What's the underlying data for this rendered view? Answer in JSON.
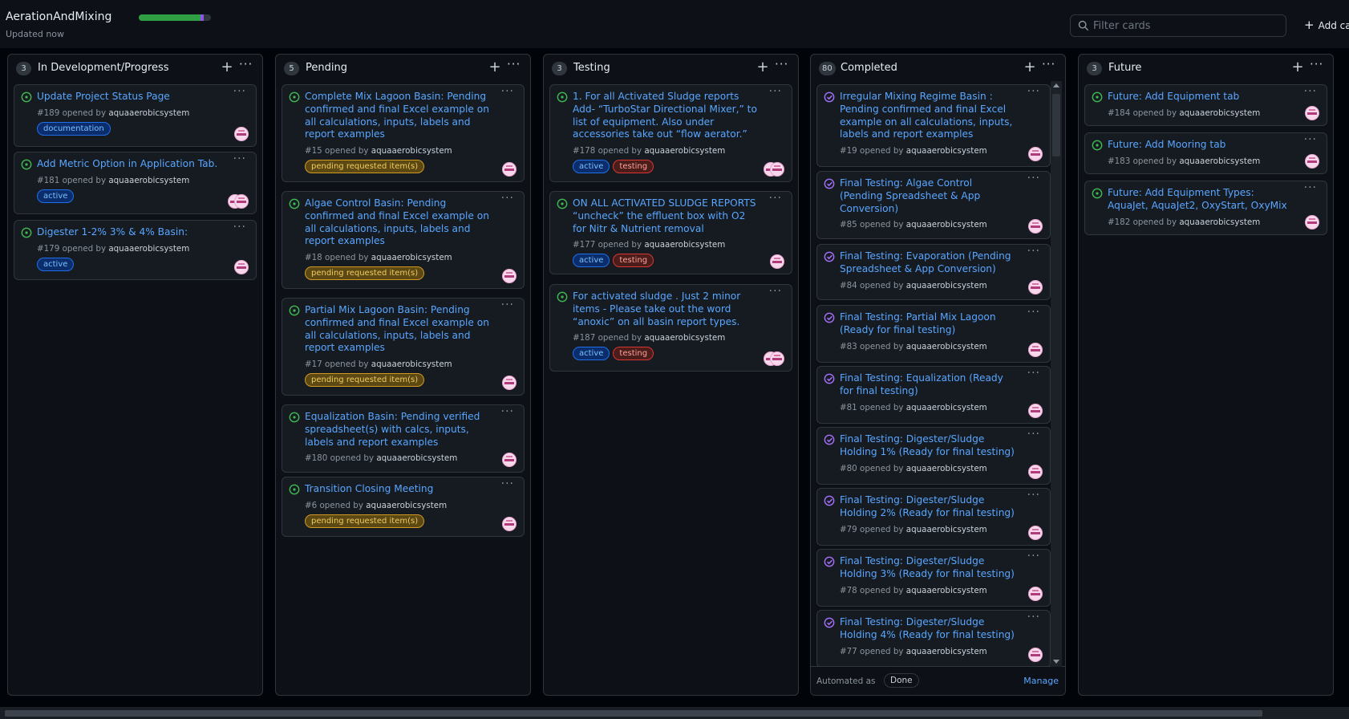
{
  "project": {
    "title": "AerationAndMixing",
    "updated": "Updated now",
    "progress_fraction": 0.9
  },
  "filter": {
    "placeholder": "Filter cards"
  },
  "add_cards_label": "Add cards",
  "colors": {
    "open_issue": "#3fb950",
    "closed_issue": "#a371f7",
    "link": "#58a6ff",
    "label_active": "#1f6feb",
    "label_testing": "#da3633",
    "label_pending": "#d29922"
  },
  "columns": [
    {
      "name": "In Development/Progress",
      "count": "3",
      "cards": [
        {
          "title": "Update Project Status Page",
          "number": "#189",
          "opened_by": "opened by",
          "author": "aquaaerobicsystem",
          "labels": [
            "documentation"
          ],
          "state": "open"
        },
        {
          "title": "Add Metric Option in Application Tab.",
          "number": "#181",
          "opened_by": "opened by",
          "author": "aquaaerobicsystem",
          "labels": [
            "active"
          ],
          "state": "open"
        },
        {
          "title": "Digester 1-2% 3% & 4% Basin:",
          "number": "#179",
          "opened_by": "opened by",
          "author": "aquaaerobicsystem",
          "labels": [
            "active"
          ],
          "state": "open"
        }
      ]
    },
    {
      "name": "Pending",
      "count": "5",
      "cards": [
        {
          "title": "Complete Mix Lagoon Basin: Pending confirmed and final Excel example on all calculations, inputs, labels and report examples",
          "number": "#15",
          "opened_by": "opened by",
          "author": "aquaaerobicsystem",
          "labels": [
            "pending requested item(s)"
          ],
          "state": "open"
        },
        {
          "title": "Algae Control Basin: Pending confirmed and final Excel example on all calculations, inputs, labels and report examples",
          "number": "#18",
          "opened_by": "opened by",
          "author": "aquaaerobicsystem",
          "labels": [
            "pending requested item(s)"
          ],
          "state": "open"
        },
        {
          "title": "Partial Mix Lagoon Basin: Pending confirmed and final Excel example on all calculations, inputs, labels and report examples",
          "number": "#17",
          "opened_by": "opened by",
          "author": "aquaaerobicsystem",
          "labels": [
            "pending requested item(s)"
          ],
          "state": "open"
        },
        {
          "title": "Equalization Basin: Pending verified spreadsheet(s) with calcs, inputs, labels and report examples",
          "number": "#180",
          "opened_by": "opened by",
          "author": "aquaaerobicsystem",
          "labels": [],
          "state": "open"
        },
        {
          "title": "Transition Closing Meeting",
          "number": "#6",
          "opened_by": "opened by",
          "author": "aquaaerobicsystem",
          "labels": [
            "pending requested item(s)"
          ],
          "state": "open"
        }
      ]
    },
    {
      "name": "Testing",
      "count": "3",
      "cards": [
        {
          "title": "1. For all Activated Sludge reports Add- “TurboStar Directional Mixer,” to list of equipment. Also under accessories take out “flow aerator.”",
          "number": "#178",
          "opened_by": "opened by",
          "author": "aquaaerobicsystem",
          "labels": [
            "active",
            "testing"
          ],
          "state": "open"
        },
        {
          "title": "ON ALL ACTIVATED SLUDGE REPORTS “uncheck” the effluent box with O2 for Nitr & Nutrient removal",
          "number": "#177",
          "opened_by": "opened by",
          "author": "aquaaerobicsystem",
          "labels": [
            "active",
            "testing"
          ],
          "state": "open"
        },
        {
          "title": "For activated sludge . Just 2 minor items - Please take out the word “anoxic” on all basin report types.",
          "number": "#187",
          "opened_by": "opened by",
          "author": "aquaaerobicsystem",
          "labels": [
            "active",
            "testing"
          ],
          "state": "open"
        }
      ]
    },
    {
      "name": "Completed",
      "count": "80",
      "cards": [
        {
          "title": "Irregular Mixing Regime Basin : Pending confirmed and final Excel example on all calculations, inputs, labels and report examples",
          "number": "#19",
          "opened_by": "opened by",
          "author": "aquaaerobicsystem",
          "labels": [],
          "state": "closed"
        },
        {
          "title": "Final Testing: Algae Control (Pending Spreadsheet & App Conversion)",
          "number": "#85",
          "opened_by": "opened by",
          "author": "aquaaerobicsystem",
          "labels": [],
          "state": "closed"
        },
        {
          "title": "Final Testing: Evaporation (Pending Spreadsheet & App Conversion)",
          "number": "#84",
          "opened_by": "opened by",
          "author": "aquaaerobicsystem",
          "labels": [],
          "state": "closed"
        },
        {
          "title": "Final Testing: Partial Mix Lagoon (Ready for final testing)",
          "number": "#83",
          "opened_by": "opened by",
          "author": "aquaaerobicsystem",
          "labels": [],
          "state": "closed"
        },
        {
          "title": "Final Testing: Equalization (Ready for final testing)",
          "number": "#81",
          "opened_by": "opened by",
          "author": "aquaaerobicsystem",
          "labels": [],
          "state": "closed"
        },
        {
          "title": "Final Testing: Digester/Sludge Holding 1% (Ready for final testing)",
          "number": "#80",
          "opened_by": "opened by",
          "author": "aquaaerobicsystem",
          "labels": [],
          "state": "closed"
        },
        {
          "title": "Final Testing: Digester/Sludge Holding 2% (Ready for final testing)",
          "number": "#79",
          "opened_by": "opened by",
          "author": "aquaaerobicsystem",
          "labels": [],
          "state": "closed"
        },
        {
          "title": "Final Testing: Digester/Sludge Holding 3% (Ready for final testing)",
          "number": "#78",
          "opened_by": "opened by",
          "author": "aquaaerobicsystem",
          "labels": [],
          "state": "closed"
        },
        {
          "title": "Final Testing: Digester/Sludge Holding 4% (Ready for final testing)",
          "number": "#77",
          "opened_by": "opened by",
          "author": "aquaaerobicsystem",
          "labels": [],
          "state": "closed"
        }
      ],
      "footer": {
        "automated_as": "Automated as",
        "automation": "Done",
        "manage": "Manage"
      }
    },
    {
      "name": "Future",
      "count": "3",
      "cards": [
        {
          "title": "Future: Add Equipment tab",
          "number": "#184",
          "opened_by": "opened by",
          "author": "aquaaerobicsystem",
          "labels": [],
          "state": "open"
        },
        {
          "title": "Future: Add Mooring tab",
          "number": "#183",
          "opened_by": "opened by",
          "author": "aquaaerobicsystem",
          "labels": [],
          "state": "open"
        },
        {
          "title": "Future: Add Equipment Types: AquaJet, AquaJet2, OxyStart, OxyMix",
          "number": "#182",
          "opened_by": "opened by",
          "author": "aquaaerobicsystem",
          "labels": [],
          "state": "open"
        }
      ]
    }
  ]
}
